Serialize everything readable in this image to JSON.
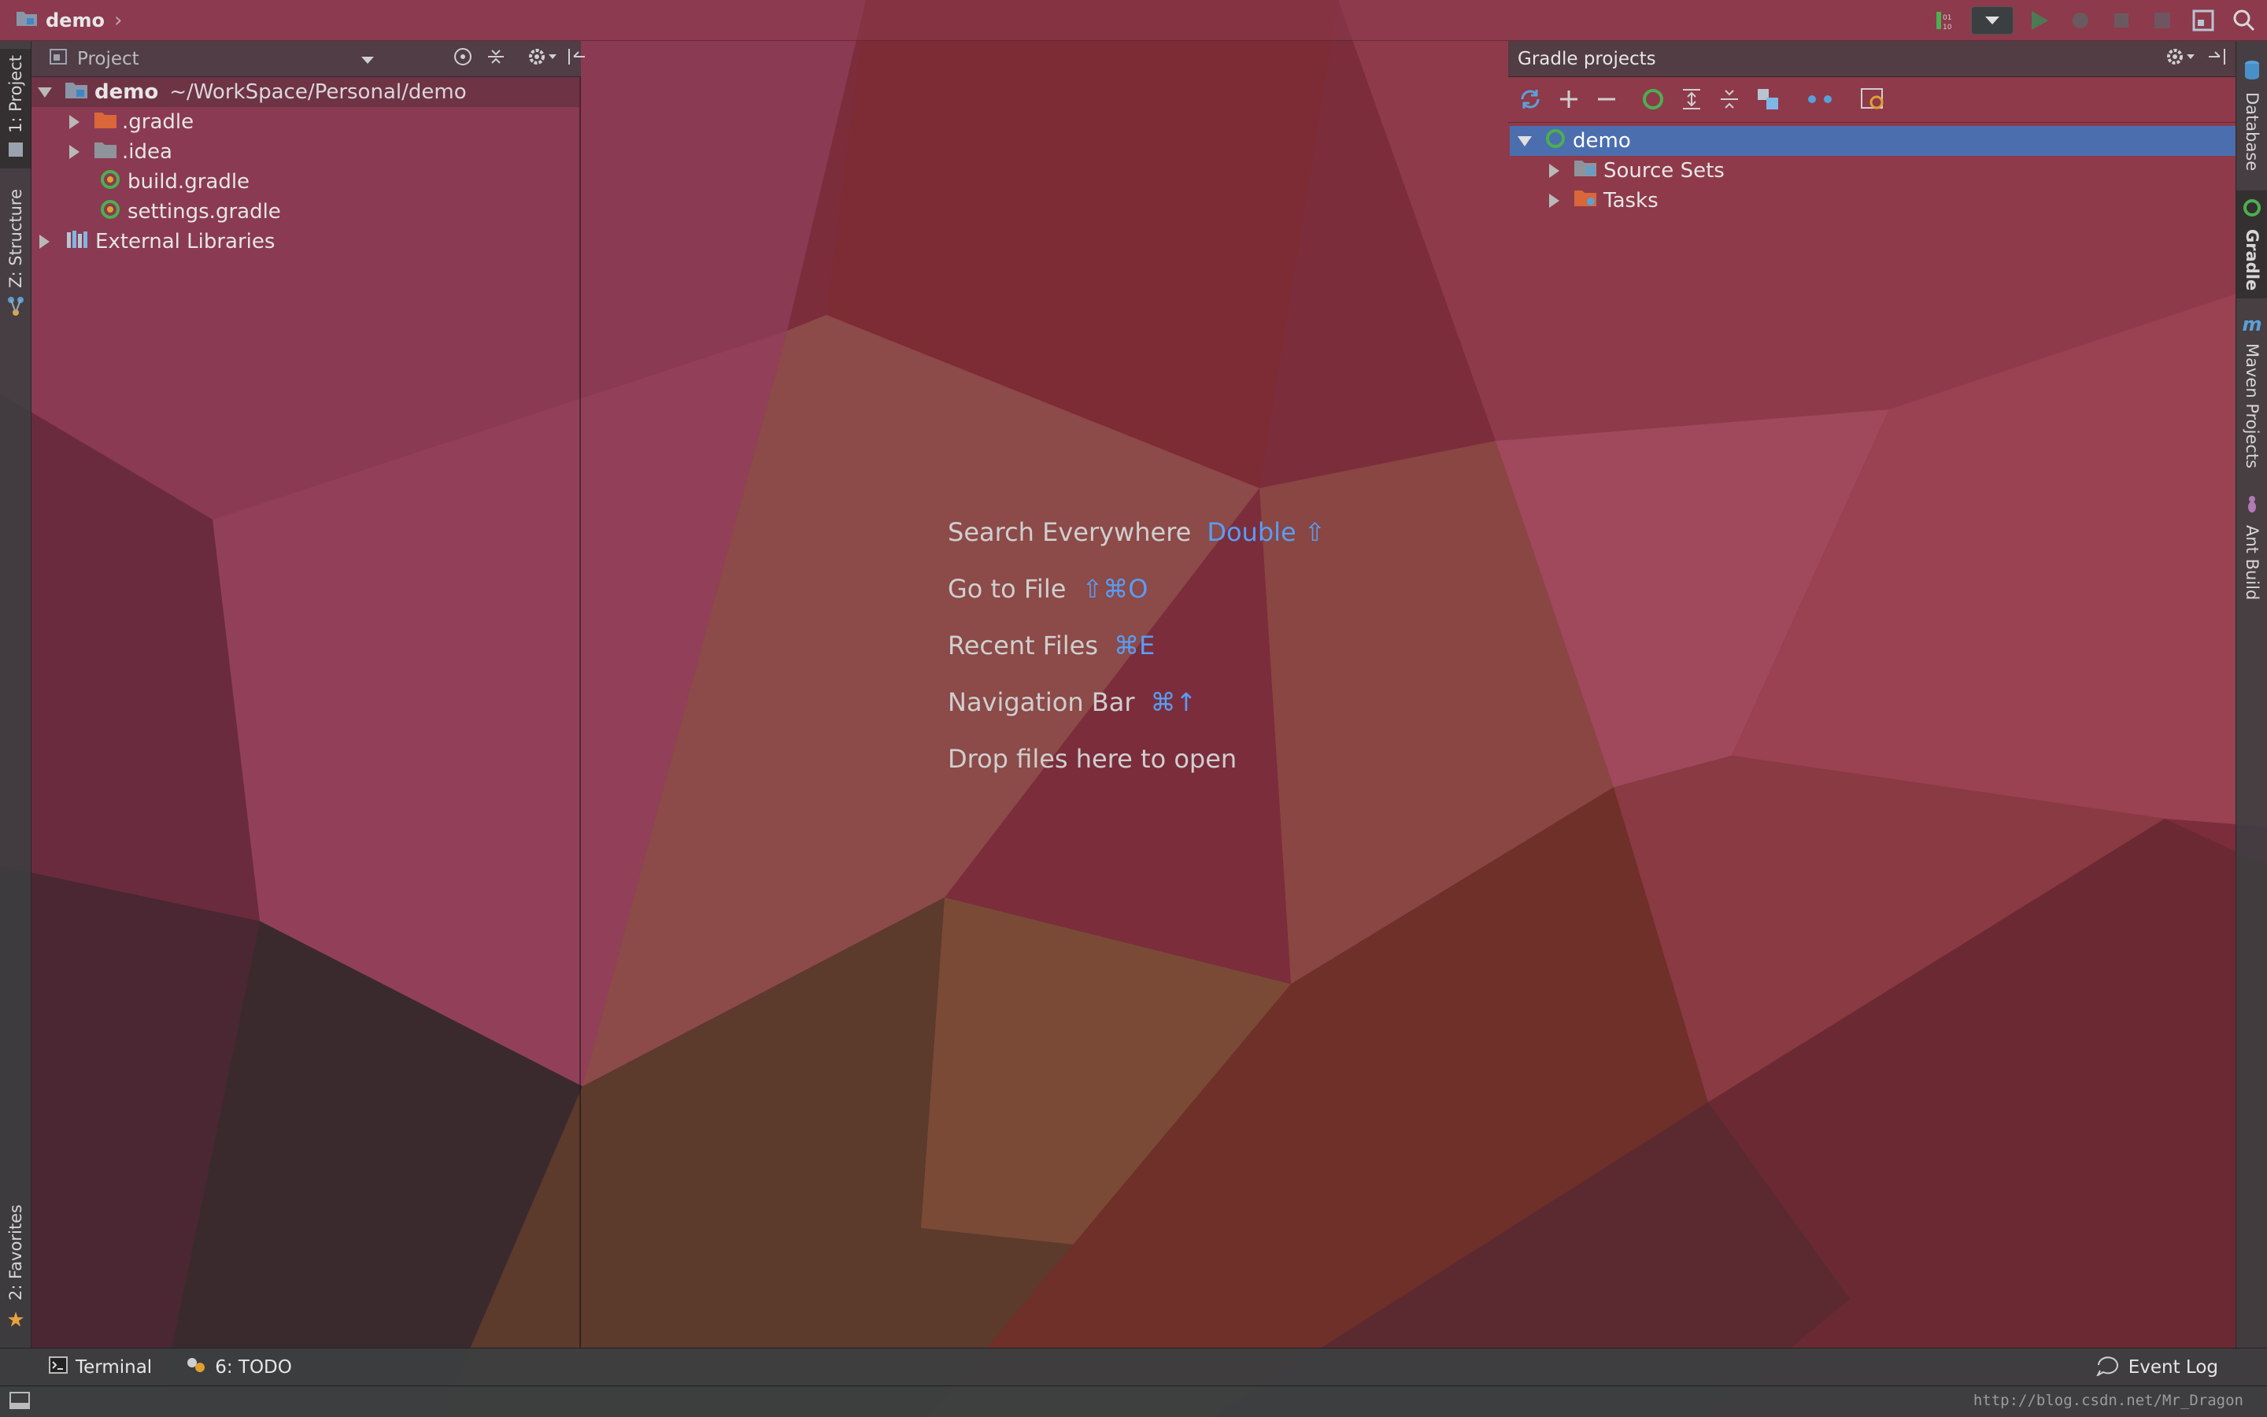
{
  "breadcrumb": {
    "project": "demo"
  },
  "left_tabs": [
    {
      "label": "1: Project"
    },
    {
      "label": "Z: Structure"
    },
    {
      "label": "2: Favorites"
    }
  ],
  "right_tabs": [
    {
      "label": "Database"
    },
    {
      "label": "Gradle"
    },
    {
      "label": "Maven Projects"
    },
    {
      "label": "Ant Build"
    }
  ],
  "project_panel": {
    "title": "Project",
    "tree": {
      "root_name": "demo",
      "root_path": "~/WorkSpace/Personal/demo",
      "children": [
        {
          "label": ".gradle",
          "icon": "folder-orange-icon"
        },
        {
          "label": ".idea",
          "icon": "folder-icon"
        },
        {
          "label": "build.gradle",
          "icon": "gradle-icon"
        },
        {
          "label": "settings.gradle",
          "icon": "gradle-icon"
        }
      ],
      "external": "External Libraries"
    }
  },
  "gradle_panel": {
    "title": "Gradle projects",
    "tree": {
      "root": "demo",
      "children": [
        {
          "label": "Source Sets"
        },
        {
          "label": "Tasks"
        }
      ]
    }
  },
  "editor_hints": [
    {
      "label": "Search Everywhere",
      "shortcut": "Double ⇧"
    },
    {
      "label": "Go to File",
      "shortcut": "⇧⌘O"
    },
    {
      "label": "Recent Files",
      "shortcut": "⌘E"
    },
    {
      "label": "Navigation Bar",
      "shortcut": "⌘↑"
    },
    {
      "label": "Drop files here to open",
      "shortcut": ""
    }
  ],
  "bottom_tools": {
    "terminal": "Terminal",
    "todo": "6: TODO",
    "event_log": "Event Log"
  },
  "watermark": "http://blog.csdn.net/Mr_Dragon"
}
